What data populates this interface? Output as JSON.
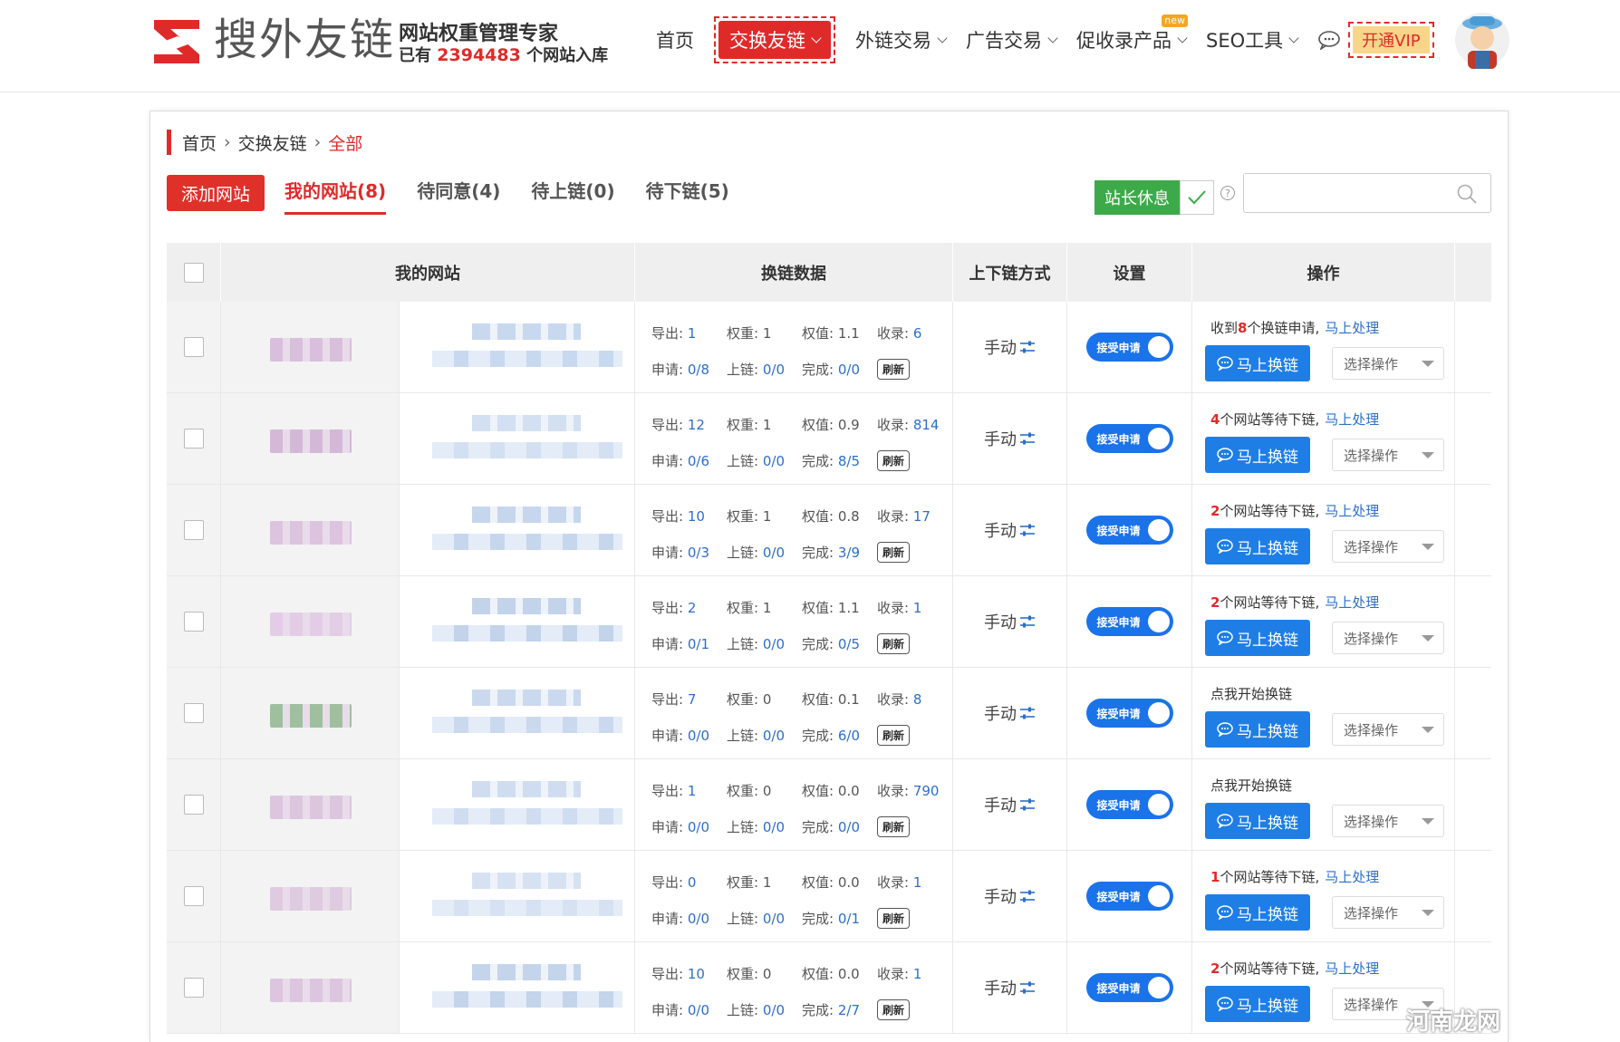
{
  "brand": {
    "name": "搜外友链",
    "tagline": "网站权重管理专家",
    "count_prefix": "已有",
    "count": "2394483",
    "count_suffix": "个网站入库"
  },
  "nav": {
    "home": "首页",
    "exchange": "交换友链",
    "outlinks": "外链交易",
    "ads": "广告交易",
    "promo": "促收录产品",
    "promo_badge": "new",
    "seo": "SEO工具",
    "vip": "开通VIP"
  },
  "breadcrumb": {
    "home": "首页",
    "section": "交换友链",
    "current": "全部"
  },
  "toolbar": {
    "add_site": "添加网站",
    "tabs": [
      "我的网站(8)",
      "待同意(4)",
      "待上链(0)",
      "待下链(5)"
    ],
    "rest_label": "站长休息",
    "search_placeholder": ""
  },
  "table": {
    "headers": {
      "site": "我的网站",
      "data": "换链数据",
      "mode": "上下链方式",
      "settings": "设置",
      "ops": "操作"
    },
    "labels": {
      "export": "导出:",
      "weight": "权重:",
      "weight_value": "权值:",
      "indexed": "收录:",
      "apply": "申请:",
      "online": "上链:",
      "done": "完成:",
      "refresh": "刷新",
      "mode": "手动",
      "toggle": "接受申请",
      "exchange_btn": "马上换链",
      "select_op": "选择操作",
      "handle_link": "马上处理"
    },
    "rows": [
      {
        "export": "1",
        "weight": "1",
        "weight_value": "1.1",
        "indexed": "6",
        "apply": "0/8",
        "online": "0/0",
        "done": "0/0",
        "status_pre": "收到",
        "status_count": "8",
        "status_post": "个换链申请,",
        "has_link": true
      },
      {
        "export": "12",
        "weight": "1",
        "weight_value": "0.9",
        "indexed": "814",
        "apply": "0/6",
        "online": "0/0",
        "done": "8/5",
        "status_pre": "",
        "status_count": "4",
        "status_post": "个网站等待下链,",
        "has_link": true
      },
      {
        "export": "10",
        "weight": "1",
        "weight_value": "0.8",
        "indexed": "17",
        "apply": "0/3",
        "online": "0/0",
        "done": "3/9",
        "status_pre": "",
        "status_count": "2",
        "status_post": "个网站等待下链,",
        "has_link": true
      },
      {
        "export": "2",
        "weight": "1",
        "weight_value": "1.1",
        "indexed": "1",
        "apply": "0/1",
        "online": "0/0",
        "done": "0/5",
        "status_pre": "",
        "status_count": "2",
        "status_post": "个网站等待下链,",
        "has_link": true
      },
      {
        "export": "7",
        "weight": "0",
        "weight_value": "0.1",
        "indexed": "8",
        "apply": "0/0",
        "online": "0/0",
        "done": "6/0",
        "status_pre": "点我开始换链",
        "status_count": "",
        "status_post": "",
        "has_link": false
      },
      {
        "export": "1",
        "weight": "0",
        "weight_value": "0.0",
        "indexed": "790",
        "apply": "0/0",
        "online": "0/0",
        "done": "0/0",
        "status_pre": "点我开始换链",
        "status_count": "",
        "status_post": "",
        "has_link": false
      },
      {
        "export": "0",
        "weight": "1",
        "weight_value": "0.0",
        "indexed": "1",
        "apply": "0/0",
        "online": "0/0",
        "done": "0/1",
        "status_pre": "",
        "status_count": "1",
        "status_post": "个网站等待下链,",
        "has_link": true
      },
      {
        "export": "10",
        "weight": "0",
        "weight_value": "0.0",
        "indexed": "1",
        "apply": "0/0",
        "online": "0/0",
        "done": "2/7",
        "status_pre": "",
        "status_count": "2",
        "status_post": "个网站等待下链,",
        "has_link": true
      }
    ]
  },
  "watermark": "河南龙网",
  "colors": {
    "brand_red": "#e02a2a",
    "link_blue": "#2c6fca",
    "button_blue": "#1e7ee6",
    "rest_green": "#3daa4a"
  }
}
